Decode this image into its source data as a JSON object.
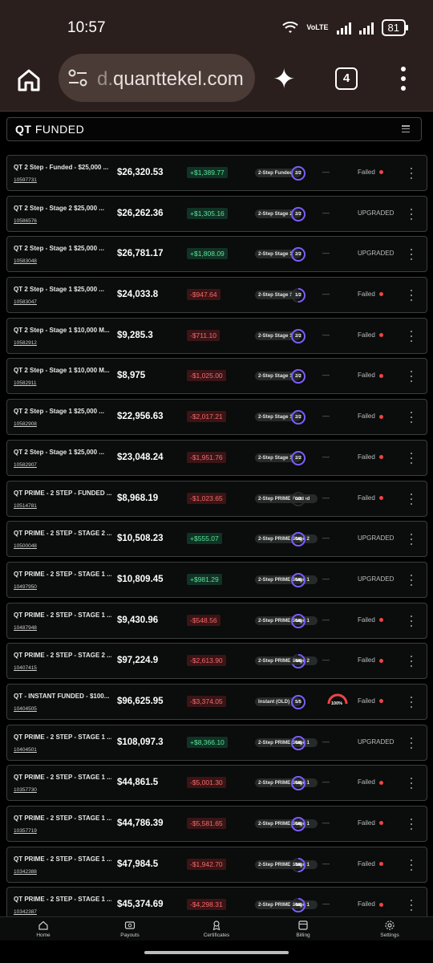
{
  "status": {
    "time": "10:57",
    "network_label": "VoLTE",
    "battery": "81"
  },
  "browser": {
    "url_prefix": "d.",
    "url_domain": "quanttekel.com",
    "tab_count": "4"
  },
  "app": {
    "logo_bold": "QT",
    "logo_rest": " FUNDED"
  },
  "rows": [
    {
      "name": "QT 2 Step - Funded - $25,000 ...",
      "id": "10597731",
      "balance": "$26,320.53",
      "pnl": "+$1,389.77",
      "pnl_sign": "pos",
      "program": "2-Step Funded",
      "ring": "2/2",
      "ring_fraction": 1.0,
      "dash": "—",
      "gauge": "",
      "status": "Failed",
      "failed": true,
      "wide": false
    },
    {
      "name": "QT 2 Step - Stage 2 $25,000 ...",
      "id": "10586576",
      "balance": "$26,262.36",
      "pnl": "+$1,305.16",
      "pnl_sign": "pos",
      "program": "2-Step Stage 2",
      "ring": "2/2",
      "ring_fraction": 1.0,
      "dash": "—",
      "gauge": "",
      "status": "UPGRADED",
      "failed": false,
      "wide": false
    },
    {
      "name": "QT 2 Step - Stage 1 $25,000 ...",
      "id": "10583048",
      "balance": "$26,781.17",
      "pnl": "+$1,808.09",
      "pnl_sign": "pos",
      "program": "2-Step Stage 1",
      "ring": "2/2",
      "ring_fraction": 1.0,
      "dash": "—",
      "gauge": "",
      "status": "UPGRADED",
      "failed": false,
      "wide": false
    },
    {
      "name": "QT 2 Step - Stage 1 $25,000 ...",
      "id": "10583047",
      "balance": "$24,033.8",
      "pnl": "-$947.64",
      "pnl_sign": "neg",
      "program": "2-Step Stage 1",
      "ring": "1/2",
      "ring_fraction": 0.5,
      "dash": "—",
      "gauge": "",
      "status": "Failed",
      "failed": true,
      "wide": false
    },
    {
      "name": "QT 2 Step - Stage 1 $10,000 M...",
      "id": "10582912",
      "balance": "$9,285.3",
      "pnl": "-$711.10",
      "pnl_sign": "neg",
      "program": "2-Step Stage 1",
      "ring": "2/2",
      "ring_fraction": 1.0,
      "dash": "—",
      "gauge": "",
      "status": "Failed",
      "failed": true,
      "wide": false
    },
    {
      "name": "QT 2 Step - Stage 1 $10,000 M...",
      "id": "10582911",
      "balance": "$8,975",
      "pnl": "-$1,025.00",
      "pnl_sign": "neg",
      "program": "2-Step Stage 1",
      "ring": "2/2",
      "ring_fraction": 1.0,
      "dash": "—",
      "gauge": "",
      "status": "Failed",
      "failed": true,
      "wide": false
    },
    {
      "name": "QT 2 Step - Stage 1 $25,000 ...",
      "id": "10582908",
      "balance": "$22,956.63",
      "pnl": "-$2,017.21",
      "pnl_sign": "neg",
      "program": "2-Step Stage 1",
      "ring": "2/2",
      "ring_fraction": 1.0,
      "dash": "—",
      "gauge": "",
      "status": "Failed",
      "failed": true,
      "wide": false
    },
    {
      "name": "QT 2 Step - Stage 1 $25,000 ...",
      "id": "10582907",
      "balance": "$23,048.24",
      "pnl": "-$1,951.76",
      "pnl_sign": "neg",
      "program": "2-Step Stage 1",
      "ring": "2/2",
      "ring_fraction": 1.0,
      "dash": "—",
      "gauge": "",
      "status": "Failed",
      "failed": true,
      "wide": false
    },
    {
      "name": "QT PRIME - 2 STEP - FUNDED ...",
      "id": "10514781",
      "balance": "$8,968.19",
      "pnl": "-$1,023.65",
      "pnl_sign": "neg",
      "program": "2-Step PRIME Funded",
      "ring": "0/2",
      "ring_fraction": 0.0,
      "dash": "—",
      "gauge": "",
      "status": "Failed",
      "failed": true,
      "wide": true
    },
    {
      "name": "QT PRIME - 2 STEP - STAGE 2 ...",
      "id": "10500048",
      "balance": "$10,508.23",
      "pnl": "+$555.07",
      "pnl_sign": "pos",
      "program": "2-Step PRIME Stage 2",
      "ring": "6/6",
      "ring_fraction": 1.0,
      "dash": "—",
      "gauge": "",
      "status": "UPGRADED",
      "failed": false,
      "wide": true
    },
    {
      "name": "QT PRIME - 2 STEP - STAGE 1 ...",
      "id": "10497950",
      "balance": "$10,809.45",
      "pnl": "+$981.29",
      "pnl_sign": "pos",
      "program": "2-Step PRIME Stage 1",
      "ring": "6/6",
      "ring_fraction": 1.0,
      "dash": "—",
      "gauge": "",
      "status": "UPGRADED",
      "failed": false,
      "wide": true
    },
    {
      "name": "QT PRIME - 2 STEP - STAGE 1 ...",
      "id": "10487948",
      "balance": "$9,430.96",
      "pnl": "-$548.56",
      "pnl_sign": "neg",
      "program": "2-Step PRIME Stage 1",
      "ring": "6/6",
      "ring_fraction": 1.0,
      "dash": "—",
      "gauge": "",
      "status": "Failed",
      "failed": true,
      "wide": true
    },
    {
      "name": "QT PRIME - 2 STEP - STAGE 2 ...",
      "id": "10407415",
      "balance": "$97,224.9",
      "pnl": "-$2,613.90",
      "pnl_sign": "neg",
      "program": "2-Step PRIME Stage 2",
      "ring": "4/6",
      "ring_fraction": 0.67,
      "dash": "—",
      "gauge": "",
      "status": "Failed",
      "failed": true,
      "wide": true
    },
    {
      "name": "QT - INSTANT FUNDED - $100...",
      "id": "10404505",
      "balance": "$96,625.95",
      "pnl": "-$3,374.05",
      "pnl_sign": "neg",
      "program": "Instant (OLD)",
      "ring": "5/5",
      "ring_fraction": 1.0,
      "dash": "",
      "gauge": "100%",
      "status": "Failed",
      "failed": true,
      "wide": false
    },
    {
      "name": "QT PRIME - 2 STEP - STAGE 1 ...",
      "id": "10404501",
      "balance": "$108,097.3",
      "pnl": "+$8,366.10",
      "pnl_sign": "pos",
      "program": "2-Step PRIME Stage 1",
      "ring": "6/6",
      "ring_fraction": 1.0,
      "dash": "—",
      "gauge": "",
      "status": "UPGRADED",
      "failed": false,
      "wide": true
    },
    {
      "name": "QT PRIME - 2 STEP - STAGE 1 ...",
      "id": "10357730",
      "balance": "$44,861.5",
      "pnl": "-$5,001.30",
      "pnl_sign": "neg",
      "program": "2-Step PRIME Stage 1",
      "ring": "6/6",
      "ring_fraction": 1.0,
      "dash": "—",
      "gauge": "",
      "status": "Failed",
      "failed": true,
      "wide": true
    },
    {
      "name": "QT PRIME - 2 STEP - STAGE 1 ...",
      "id": "10357719",
      "balance": "$44,786.39",
      "pnl": "-$5,581.65",
      "pnl_sign": "neg",
      "program": "2-Step PRIME Stage 1",
      "ring": "6/6",
      "ring_fraction": 1.0,
      "dash": "—",
      "gauge": "",
      "status": "Failed",
      "failed": true,
      "wide": true
    },
    {
      "name": "QT PRIME - 2 STEP - STAGE 1 ...",
      "id": "10342388",
      "balance": "$47,984.5",
      "pnl": "-$1,942.70",
      "pnl_sign": "neg",
      "program": "2-Step PRIME Stage 1",
      "ring": "3/6",
      "ring_fraction": 0.5,
      "dash": "—",
      "gauge": "",
      "status": "Failed",
      "failed": true,
      "wide": true
    },
    {
      "name": "QT PRIME - 2 STEP - STAGE 1 ...",
      "id": "10342387",
      "balance": "$45,374.69",
      "pnl": "-$4,298.31",
      "pnl_sign": "neg",
      "program": "2-Step PRIME Stage 1",
      "ring": "4/6",
      "ring_fraction": 0.67,
      "dash": "—",
      "gauge": "",
      "status": "Failed",
      "failed": true,
      "wide": true
    }
  ],
  "nav": [
    {
      "label": "Home",
      "icon": "home-icon"
    },
    {
      "label": "Payouts",
      "icon": "payouts-icon"
    },
    {
      "label": "Certificates",
      "icon": "certificate-icon"
    },
    {
      "label": "Billing",
      "icon": "billing-icon"
    },
    {
      "label": "Settings",
      "icon": "settings-icon"
    }
  ],
  "colors": {
    "accent": "#7c5cff",
    "positive": "#5ee09a",
    "negative": "#f36b6b",
    "failed_dot": "#ef4444",
    "gauge": "#ef4444"
  }
}
